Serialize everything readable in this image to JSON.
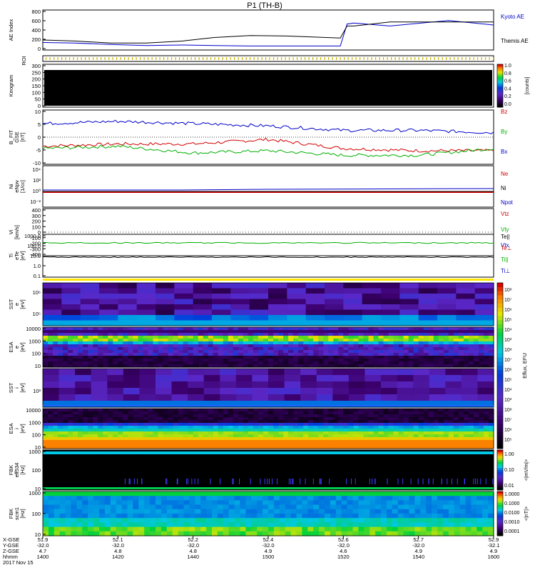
{
  "title": "P1 (TH-B)",
  "panels": {
    "ae": {
      "ylabel": "AE Index",
      "ticks": [
        "800",
        "600",
        "400",
        "200",
        "0"
      ],
      "legend": [
        {
          "text": "Kyoto AE",
          "color": "#0000c8"
        },
        {
          "text": "Themis AE",
          "color": "#000000"
        }
      ]
    },
    "roi": {
      "ylabel": "ROI"
    },
    "keogram": {
      "ylabel": "Keogram",
      "ticks": [
        "300",
        "250",
        "200",
        "150",
        "100",
        "50",
        "0"
      ],
      "cbar_ticks": [
        "1.0",
        "0.8",
        "0.6",
        "0.4",
        "0.2",
        "0.0"
      ],
      "cbar_label": "[counts]"
    },
    "bfield": {
      "ylabel": "B_FIT",
      "ylabel2": "GSE",
      "ylabel3": "[nT]",
      "ticks": [
        "10",
        "5",
        "0",
        "-5",
        "-10"
      ],
      "legend": [
        {
          "text": "Bz",
          "color": "#d00000"
        },
        {
          "text": "By",
          "color": "#00b000"
        },
        {
          "text": "Bx",
          "color": "#0000c8"
        }
      ]
    },
    "density": {
      "ylabel": "Ni",
      "ylabel2": "eNpv",
      "ylabel3": "[1/cc]",
      "legend": [
        {
          "text": "Ne",
          "color": "#d00000"
        },
        {
          "text": "Ni",
          "color": "#000000"
        },
        {
          "text": "Npot",
          "color": "#0000c8"
        }
      ]
    },
    "velocity": {
      "ylabel": "Vi",
      "ylabel3": "[km/s]",
      "ticks": [
        "400",
        "300",
        "200",
        "100",
        "0",
        "-100",
        "-200",
        "-300",
        "-400"
      ],
      "legend": [
        {
          "text": "Vtz",
          "color": "#d00000"
        },
        {
          "text": "Vty",
          "color": "#00b000"
        },
        {
          "text": "Vtx",
          "color": "#0000c8"
        }
      ]
    },
    "temperature": {
      "ylabel": "Ti",
      "ylabel2": "eTe",
      "ylabel3": "[eV]",
      "ticks": [
        "1000.0",
        "100.0",
        "10.0",
        "1.0",
        "0.1"
      ],
      "legend": [
        {
          "text": "Te||",
          "color": "#000000"
        },
        {
          "text": "Te⊥",
          "color": "#d00000"
        },
        {
          "text": "Ti||",
          "color": "#00b000"
        },
        {
          "text": "Ti⊥",
          "color": "#0000c8"
        }
      ]
    },
    "sst_e": {
      "ylabel": "SST",
      "ylabel2": "e",
      "ylabel3": "[eV]"
    },
    "esa_e": {
      "ylabel": "ESA",
      "ylabel2": "e",
      "ylabel3": "[eV]",
      "ticks": [
        "10000",
        "1000",
        "100",
        "10"
      ]
    },
    "sst_i": {
      "ylabel": "SST",
      "ylabel2": "i",
      "ylabel3": "[eV]"
    },
    "esa_i": {
      "ylabel": "ESA",
      "ylabel2": "i",
      "ylabel3": "[eV]",
      "ticks": [
        "10000",
        "1000",
        "100",
        "10"
      ]
    },
    "fbk_b": {
      "ylabel": "FBK",
      "ylabel2": "eff534",
      "ylabel3": "[Hz]",
      "ticks": [
        "1000",
        "100",
        "10"
      ],
      "cbar_ticks": [
        "1.00",
        "0.10",
        "0.01"
      ],
      "cbar_label": "<|mV/m|>"
    },
    "fbk_e": {
      "ylabel": "FBK",
      "ylabel2": "scm1",
      "ylabel3": "[Hz]",
      "ticks": [
        "1000",
        "100",
        "10"
      ],
      "cbar_ticks": [
        "1.0000",
        "0.1000",
        "0.0100",
        "0.0010",
        "0.0001"
      ],
      "cbar_label": "<|nT|>"
    },
    "eflux_cbar": {
      "label": "Eflux, EFU"
    }
  },
  "time_axis": {
    "row_labels": [
      "X-GSE",
      "Y-GSE",
      "Z-GSE",
      "hhmm",
      "2017 Nov 15"
    ],
    "columns": [
      {
        "x": "51.9",
        "y": "-32.0",
        "z": "4.7",
        "t": "1400"
      },
      {
        "x": "52.1",
        "y": "-32.0",
        "z": "4.8",
        "t": "1420"
      },
      {
        "x": "52.2",
        "y": "-32.0",
        "z": "4.8",
        "t": "1440"
      },
      {
        "x": "52.4",
        "y": "-32.0",
        "z": "4.9",
        "t": "1500"
      },
      {
        "x": "52.6",
        "y": "-32.0",
        "z": "4.6",
        "t": "1520"
      },
      {
        "x": "52.7",
        "y": "-32.0",
        "z": "4.9",
        "t": "1540"
      },
      {
        "x": "52.9",
        "y": "-32.1",
        "z": "4.9",
        "t": "1600"
      }
    ]
  },
  "chart_data": [
    {
      "type": "line",
      "panel": "AE Index",
      "x": [
        "1400",
        "1410",
        "1420",
        "1430",
        "1440",
        "1450",
        "1500",
        "1510",
        "1520",
        "1525",
        "1530",
        "1540",
        "1550",
        "1600"
      ],
      "series": [
        {
          "name": "Kyoto AE",
          "values": [
            150,
            140,
            110,
            90,
            100,
            90,
            80,
            80,
            80,
            520,
            540,
            480,
            590,
            500
          ]
        },
        {
          "name": "Themis AE",
          "values": [
            200,
            180,
            140,
            140,
            180,
            250,
            290,
            280,
            240,
            480,
            480,
            560,
            560,
            560
          ]
        }
      ],
      "ylim": [
        0,
        800
      ]
    },
    {
      "type": "line",
      "panel": "B_FIT GSE [nT]",
      "x": [
        "1400",
        "1420",
        "1440",
        "1500",
        "1520",
        "1540",
        "1600"
      ],
      "series": [
        {
          "name": "Bz",
          "values": [
            -4,
            -3,
            -3,
            -1,
            -5,
            -6,
            -6
          ]
        },
        {
          "name": "By",
          "values": [
            -5,
            -4,
            -7,
            -6,
            -8,
            -8,
            -5
          ]
        },
        {
          "name": "Bx",
          "values": [
            6,
            7,
            6,
            5,
            3,
            3,
            2
          ]
        }
      ],
      "ylim": [
        -12,
        12
      ]
    },
    {
      "type": "line",
      "panel": "Ti eTe [eV]",
      "x": [
        "1400",
        "1500",
        "1600"
      ],
      "series": [
        {
          "name": "Ti||",
          "values": [
            1000,
            1000,
            1000
          ]
        },
        {
          "name": "Te||",
          "values": [
            10,
            10,
            10
          ]
        }
      ]
    }
  ]
}
